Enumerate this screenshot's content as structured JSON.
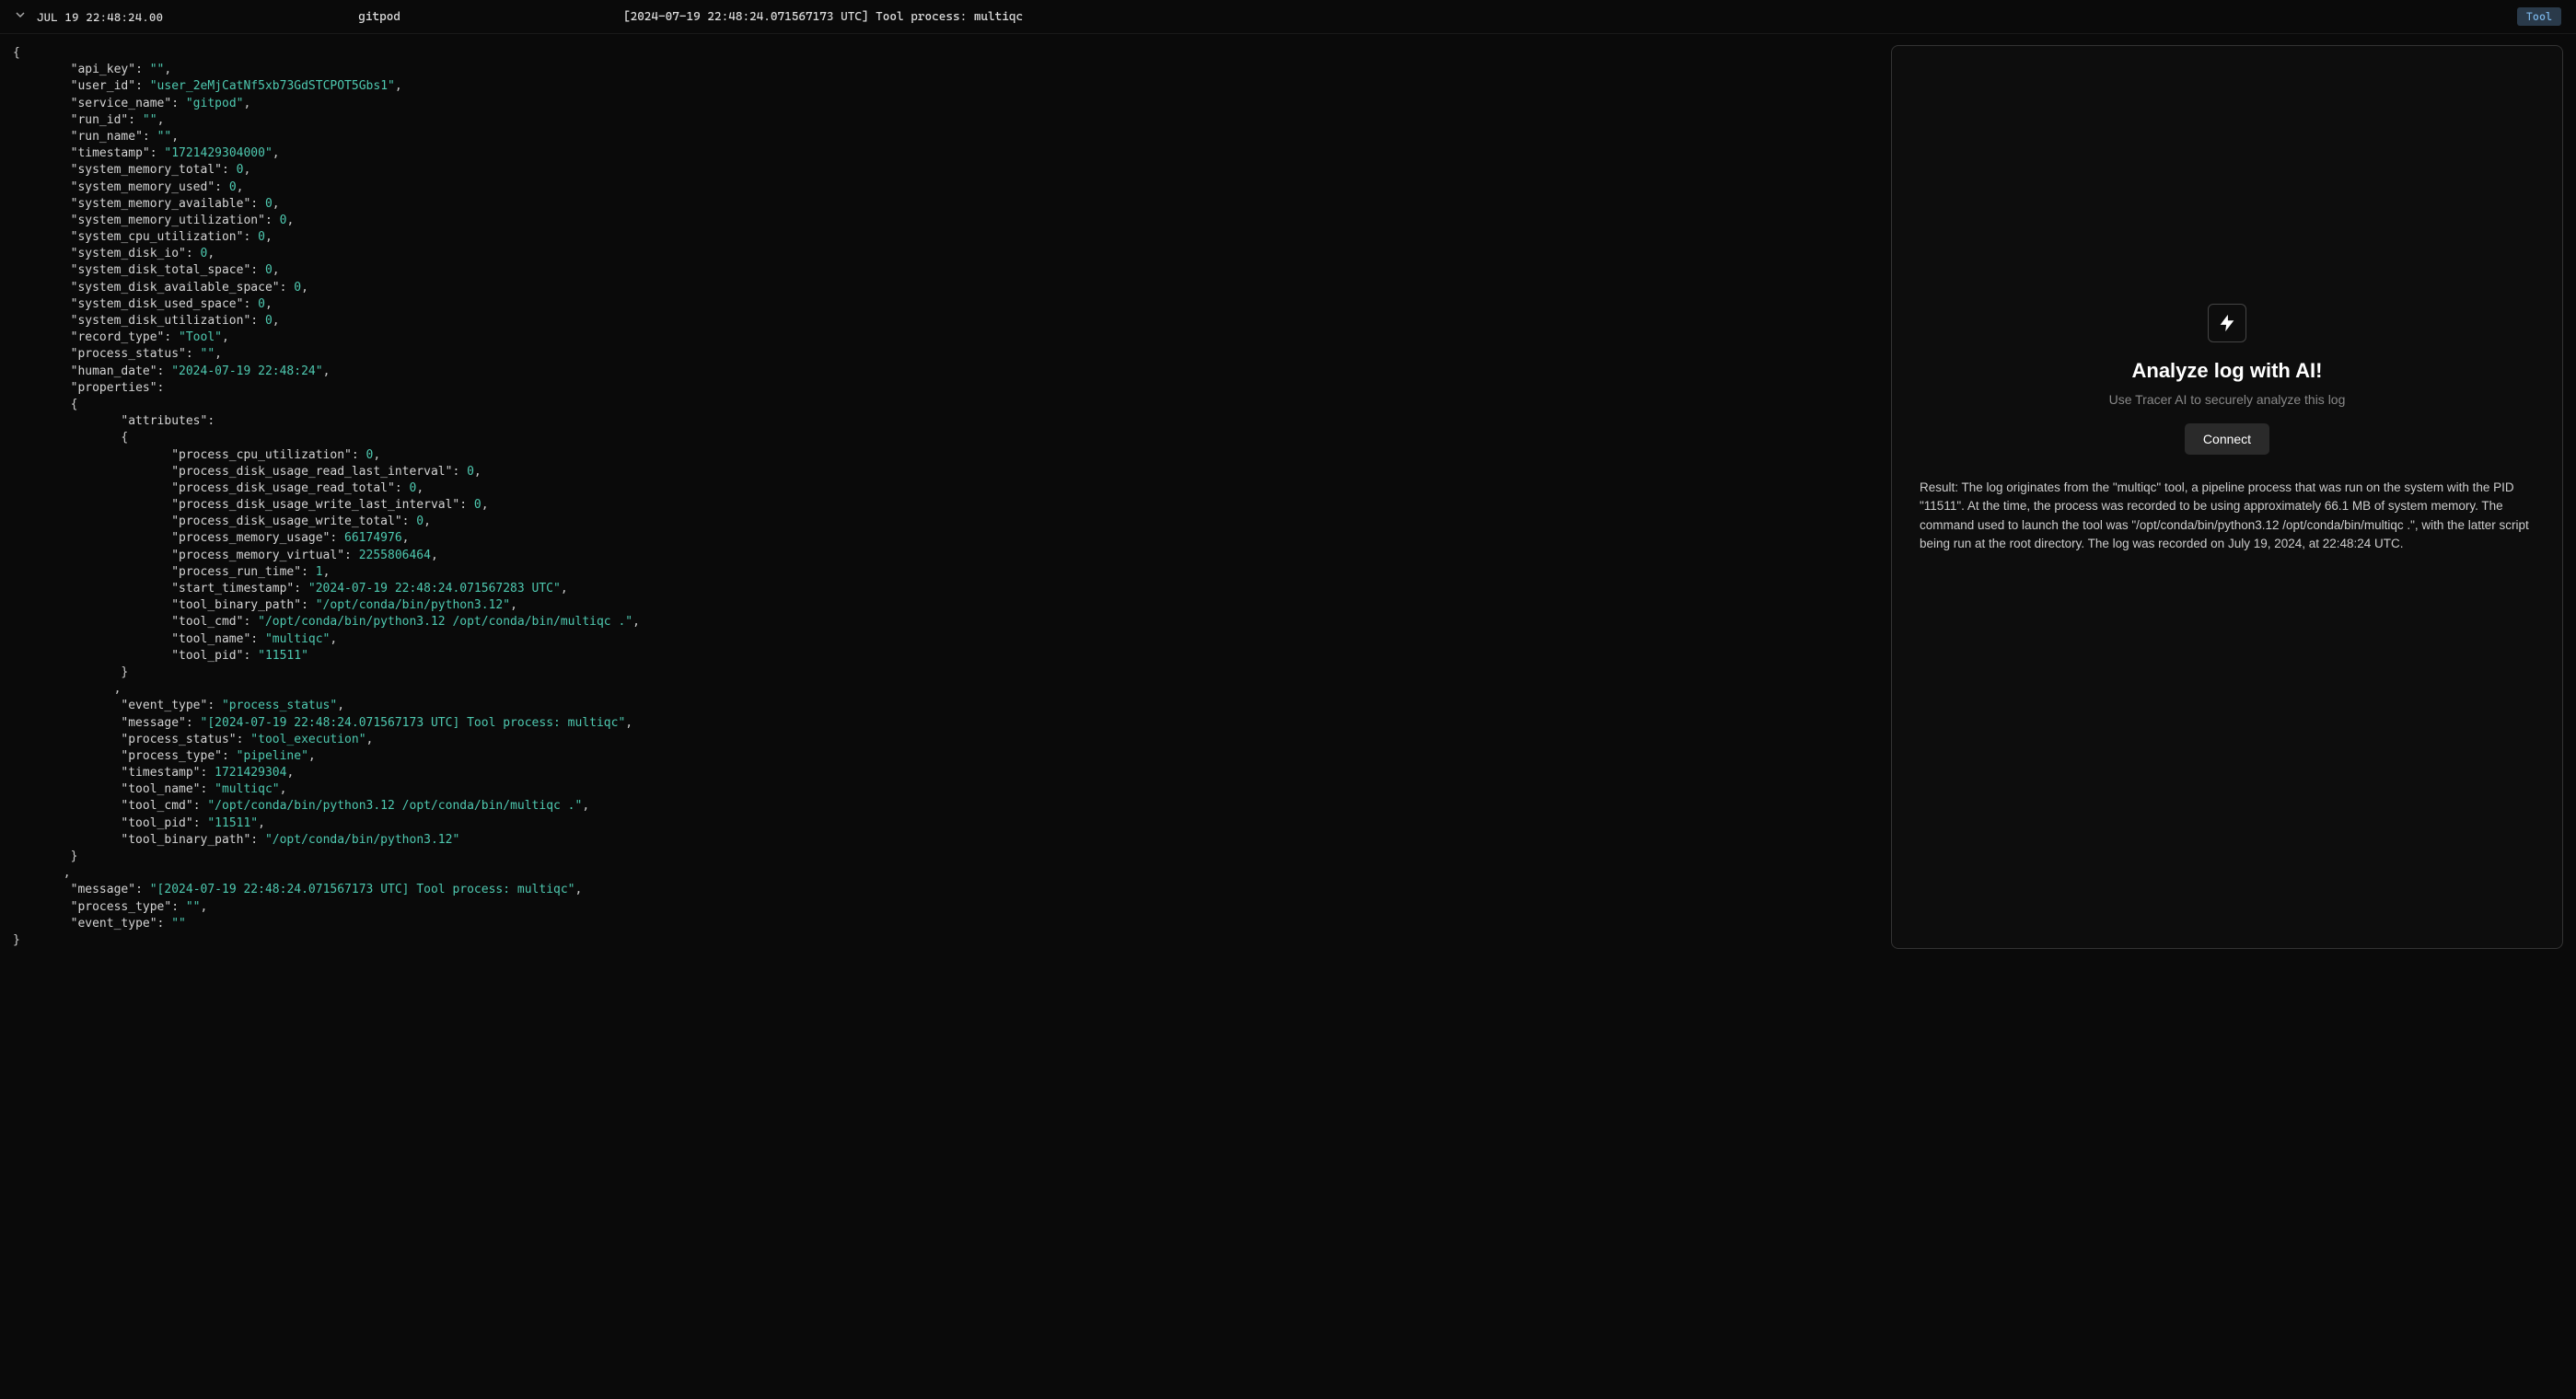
{
  "header": {
    "timestamp": "JUL 19 22:48:24.00",
    "service": "gitpod",
    "message": "[2024-07-19 22:48:24.071567173 UTC] Tool process: multiqc",
    "badge": "Tool"
  },
  "json": {
    "api_key": "",
    "user_id": "user_2eMjCatNf5xb73GdSTCPOT5Gbs1",
    "service_name": "gitpod",
    "run_id": "",
    "run_name": "",
    "timestamp": "1721429304000",
    "system_memory_total": 0,
    "system_memory_used": 0,
    "system_memory_available": 0,
    "system_memory_utilization": 0,
    "system_cpu_utilization": 0,
    "system_disk_io": 0,
    "system_disk_total_space": 0,
    "system_disk_available_space": 0,
    "system_disk_used_space": 0,
    "system_disk_utilization": 0,
    "record_type": "Tool",
    "process_status": "",
    "human_date": "2024-07-19 22:48:24",
    "properties": {
      "attributes": {
        "process_cpu_utilization": 0,
        "process_disk_usage_read_last_interval": 0,
        "process_disk_usage_read_total": 0,
        "process_disk_usage_write_last_interval": 0,
        "process_disk_usage_write_total": 0,
        "process_memory_usage": 66174976,
        "process_memory_virtual": 2255806464,
        "process_run_time": 1,
        "start_timestamp": "2024-07-19 22:48:24.071567283 UTC",
        "tool_binary_path": "/opt/conda/bin/python3.12",
        "tool_cmd": "/opt/conda/bin/python3.12 /opt/conda/bin/multiqc .",
        "tool_name": "multiqc",
        "tool_pid": "11511"
      },
      "event_type": "process_status",
      "p_message": "[2024-07-19 22:48:24.071567173 UTC] Tool process: multiqc",
      "p_process_status": "tool_execution",
      "process_type": "pipeline",
      "p_timestamp": 1721429304,
      "p_tool_name": "multiqc",
      "p_tool_cmd": "/opt/conda/bin/python3.12 /opt/conda/bin/multiqc .",
      "p_tool_pid": "11511",
      "p_tool_binary_path": "/opt/conda/bin/python3.12"
    },
    "root_message": "[2024-07-19 22:48:24.071567173 UTC] Tool process: multiqc",
    "root_process_type": "",
    "root_event_type": ""
  },
  "ai": {
    "title": "Analyze log with AI!",
    "subtitle": "Use Tracer AI to securely analyze this log",
    "connect": "Connect",
    "result": "Result: The log originates from the \"multiqc\" tool, a pipeline process that was run on the system with the PID \"11511\". At the time, the process was recorded to be using approximately 66.1 MB of system memory. The command used to launch the tool was \"/opt/conda/bin/python3.12 /opt/conda/bin/multiqc .\", with the latter script being run at the root directory. The log was recorded on July 19, 2024, at 22:48:24 UTC."
  }
}
